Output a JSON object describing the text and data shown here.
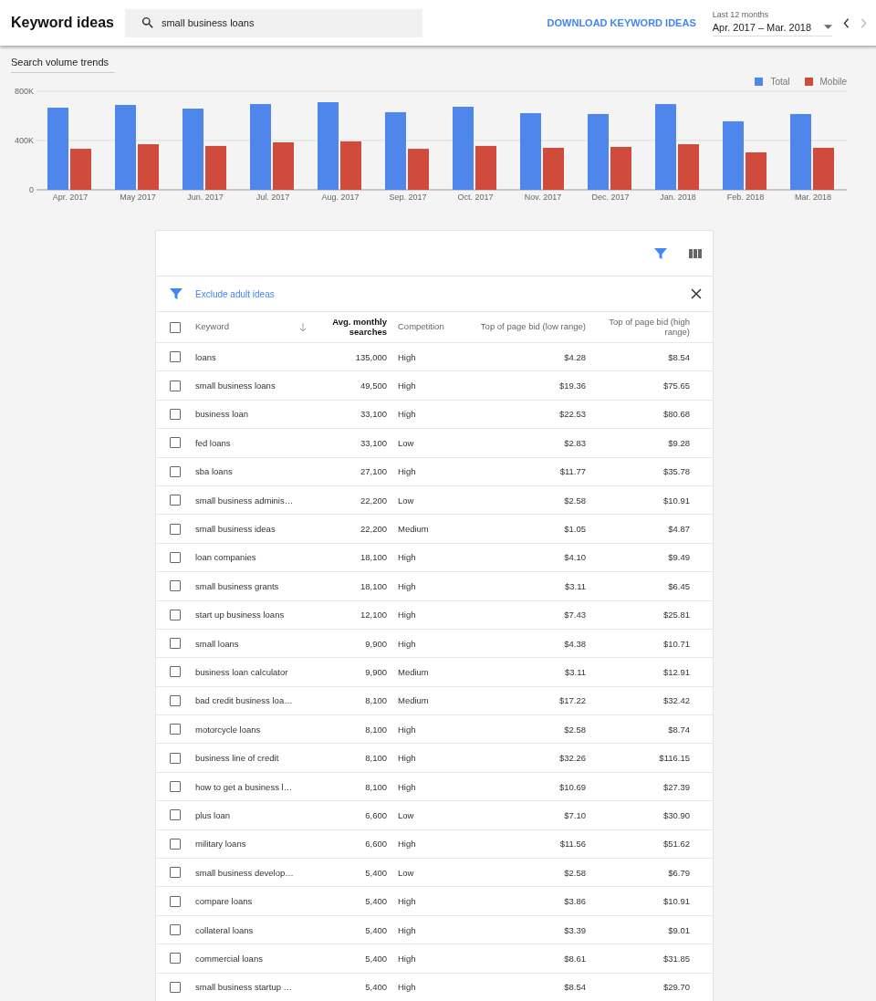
{
  "header": {
    "title": "Keyword ideas",
    "search": {
      "value": "small business loans"
    },
    "download": "DOWNLOAD KEYWORD IDEAS",
    "range_label": "Last 12 months",
    "range": "Apr. 2017 – Mar. 2018"
  },
  "trends": {
    "selector": "Search volume trends",
    "chart_data": {
      "type": "bar",
      "categories": [
        "Apr. 2017",
        "May 2017",
        "Jun. 2017",
        "Jul. 2017",
        "Aug. 2017",
        "Sep. 2017",
        "Oct. 2017",
        "Nov. 2017",
        "Dec. 2017",
        "Jan. 2018",
        "Feb. 2018",
        "Mar. 2018"
      ],
      "series": [
        {
          "name": "Total",
          "color": "#4f86ec",
          "values": [
            667000,
            689000,
            659000,
            696000,
            711000,
            630000,
            674000,
            622000,
            615000,
            696000,
            556000,
            615000
          ]
        },
        {
          "name": "Mobile",
          "color": "#d04b3c",
          "values": [
            333000,
            370000,
            356000,
            385000,
            393000,
            333000,
            356000,
            341000,
            348000,
            370000,
            304000,
            341000
          ]
        }
      ],
      "ylim": [
        0,
        800000
      ],
      "yticks": [
        {
          "value": 0,
          "label": "0"
        },
        {
          "value": 400000,
          "label": "400K"
        },
        {
          "value": 800000,
          "label": "800K"
        }
      ]
    }
  },
  "table": {
    "filter": "Exclude adult ideas",
    "columns": [
      {
        "label": "Keyword",
        "bold": false
      },
      {
        "label": "Avg. monthly searches",
        "bold": true
      },
      {
        "label": "Competition",
        "bold": false
      },
      {
        "label": "Top of page bid (low range)",
        "bold": false
      },
      {
        "label": "Top of page bid (high range)",
        "bold": false
      }
    ],
    "header_checked": false,
    "rows": [
      {
        "keyword": "loans",
        "searches": "135,000",
        "competition": "High",
        "low": "$4.28",
        "high": "$8.54",
        "checked": false
      },
      {
        "keyword": "small business loans",
        "searches": "49,500",
        "competition": "High",
        "low": "$19.36",
        "high": "$75.65",
        "checked": false
      },
      {
        "keyword": "business loan",
        "searches": "33,100",
        "competition": "High",
        "low": "$22.53",
        "high": "$80.68",
        "checked": false
      },
      {
        "keyword": "fed loans",
        "searches": "33,100",
        "competition": "Low",
        "low": "$2.83",
        "high": "$9.28",
        "checked": false
      },
      {
        "keyword": "sba loans",
        "searches": "27,100",
        "competition": "High",
        "low": "$11.77",
        "high": "$35.78",
        "checked": false
      },
      {
        "keyword": "small business adminis…",
        "searches": "22,200",
        "competition": "Low",
        "low": "$2.58",
        "high": "$10.91",
        "checked": false
      },
      {
        "keyword": "small business ideas",
        "searches": "22,200",
        "competition": "Medium",
        "low": "$1.05",
        "high": "$4.87",
        "checked": false
      },
      {
        "keyword": "loan companies",
        "searches": "18,100",
        "competition": "High",
        "low": "$4.10",
        "high": "$9.49",
        "checked": false
      },
      {
        "keyword": "small business grants",
        "searches": "18,100",
        "competition": "High",
        "low": "$3.11",
        "high": "$6.45",
        "checked": false
      },
      {
        "keyword": "start up business loans",
        "searches": "12,100",
        "competition": "High",
        "low": "$7.43",
        "high": "$25.81",
        "checked": false
      },
      {
        "keyword": "small loans",
        "searches": "9,900",
        "competition": "High",
        "low": "$4.38",
        "high": "$10.71",
        "checked": false
      },
      {
        "keyword": "business loan calculator",
        "searches": "9,900",
        "competition": "Medium",
        "low": "$3.11",
        "high": "$12.91",
        "checked": false
      },
      {
        "keyword": "bad credit business loa…",
        "searches": "8,100",
        "competition": "Medium",
        "low": "$17.22",
        "high": "$32.42",
        "checked": false
      },
      {
        "keyword": "motorcycle loans",
        "searches": "8,100",
        "competition": "High",
        "low": "$2.58",
        "high": "$8.74",
        "checked": false
      },
      {
        "keyword": "business line of credit",
        "searches": "8,100",
        "competition": "High",
        "low": "$32.26",
        "high": "$116.15",
        "checked": false
      },
      {
        "keyword": "how to get a business l…",
        "searches": "8,100",
        "competition": "High",
        "low": "$10.69",
        "high": "$27.39",
        "checked": false
      },
      {
        "keyword": "plus loan",
        "searches": "6,600",
        "competition": "Low",
        "low": "$7.10",
        "high": "$30.90",
        "checked": false
      },
      {
        "keyword": "military loans",
        "searches": "6,600",
        "competition": "High",
        "low": "$11.56",
        "high": "$51.62",
        "checked": false
      },
      {
        "keyword": "small business develop…",
        "searches": "5,400",
        "competition": "Low",
        "low": "$2.58",
        "high": "$6.79",
        "checked": false
      },
      {
        "keyword": "compare loans",
        "searches": "5,400",
        "competition": "High",
        "low": "$3.86",
        "high": "$10.91",
        "checked": false
      },
      {
        "keyword": "collateral loans",
        "searches": "5,400",
        "competition": "High",
        "low": "$3.39",
        "high": "$9.01",
        "checked": false
      },
      {
        "keyword": "commercial loans",
        "searches": "5,400",
        "competition": "High",
        "low": "$8.61",
        "high": "$31.85",
        "checked": false
      },
      {
        "keyword": "small business startup …",
        "searches": "5,400",
        "competition": "High",
        "low": "$8.54",
        "high": "$29.70",
        "checked": false
      }
    ]
  }
}
